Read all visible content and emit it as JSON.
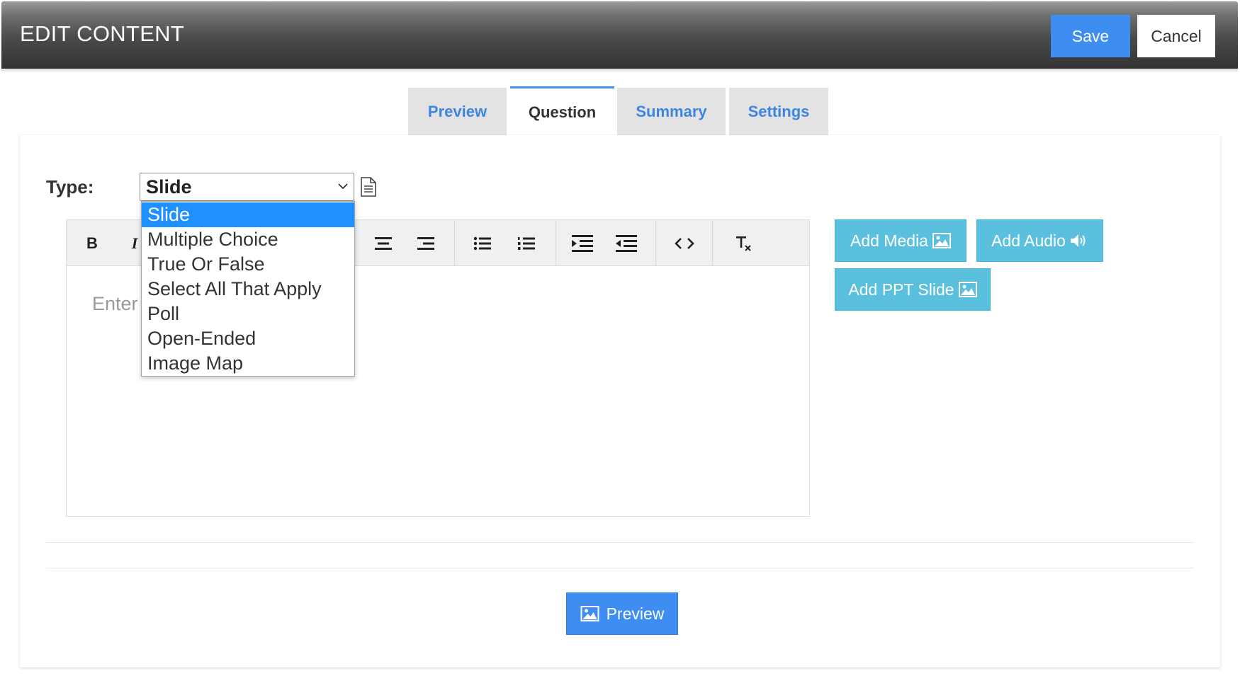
{
  "header": {
    "title": "EDIT CONTENT",
    "save_label": "Save",
    "cancel_label": "Cancel"
  },
  "tabs": [
    {
      "label": "Preview",
      "active": false
    },
    {
      "label": "Question",
      "active": true
    },
    {
      "label": "Summary",
      "active": false
    },
    {
      "label": "Settings",
      "active": false
    }
  ],
  "type": {
    "label": "Type:",
    "selected": "Slide",
    "options": [
      "Slide",
      "Multiple Choice",
      "True Or False",
      "Select All That Apply",
      "Poll",
      "Open-Ended",
      "Image Map"
    ]
  },
  "editor": {
    "placeholder": "Enter",
    "toolbar_icons": [
      "bold-icon",
      "italic-icon",
      "align-center-icon",
      "align-right-icon",
      "bulleted-list-icon",
      "numbered-list-icon",
      "indent-icon",
      "outdent-icon",
      "source-code-icon",
      "clear-format-icon"
    ],
    "bold_glyph": "B",
    "italic_glyph": "I"
  },
  "media": {
    "add_media_label": "Add Media",
    "add_audio_label": "Add Audio",
    "add_ppt_label": "Add PPT Slide"
  },
  "footer": {
    "preview_label": "Preview"
  },
  "colors": {
    "accent": "#3d8ef0",
    "tab_text": "#3d86e0",
    "info_button": "#5bc0de",
    "selected_option": "#1e90ff"
  }
}
